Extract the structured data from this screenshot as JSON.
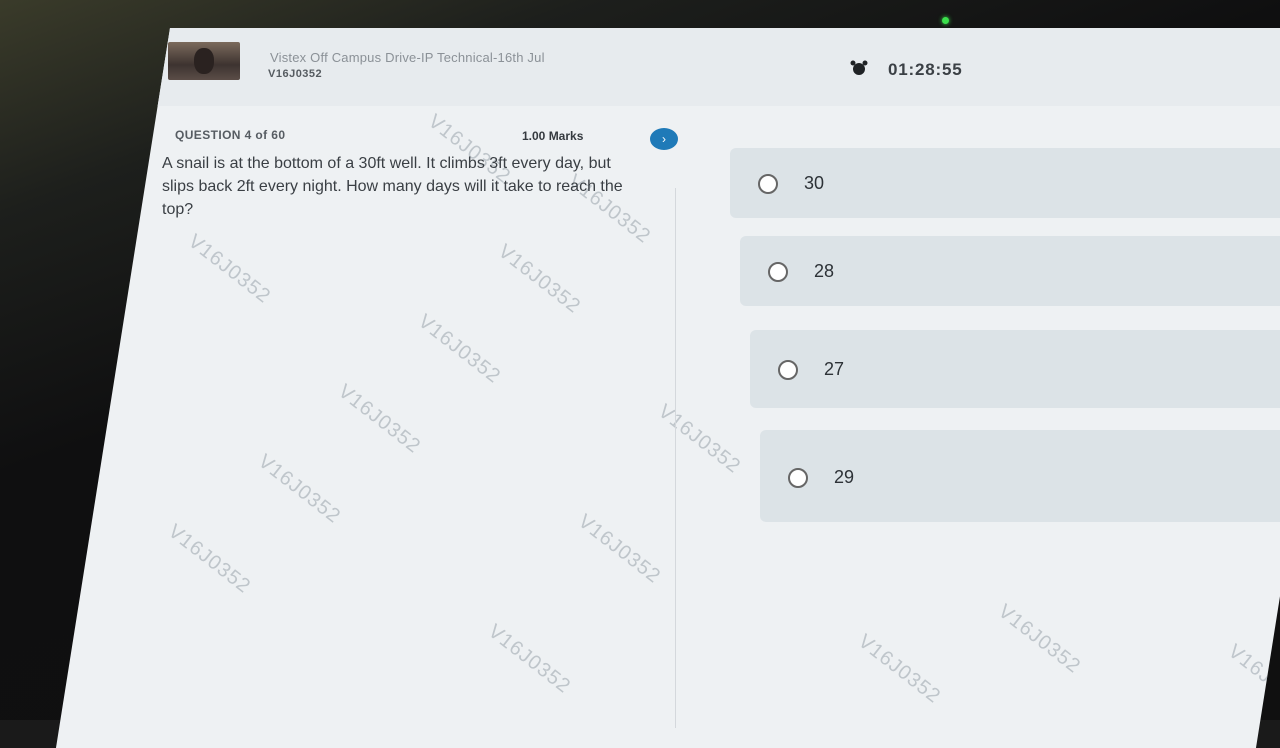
{
  "header": {
    "title": "Vistex Off Campus Drive-IP Technical-16th Jul",
    "user_id": "V16J0352",
    "timer": "01:28:55"
  },
  "question": {
    "label": "QUESTION 4 of 60",
    "marks": "1.00 Marks",
    "next_icon": "›",
    "text": "A snail is at the bottom of a 30ft well. It climbs 3ft every day, but slips back 2ft every night. How many days will it take to reach the top?"
  },
  "options": [
    {
      "label": "30"
    },
    {
      "label": "28"
    },
    {
      "label": "27"
    },
    {
      "label": "29"
    }
  ],
  "watermark": "V16J0352",
  "colors": {
    "accent": "#1f7ab8",
    "status_led": "#3be04c"
  }
}
